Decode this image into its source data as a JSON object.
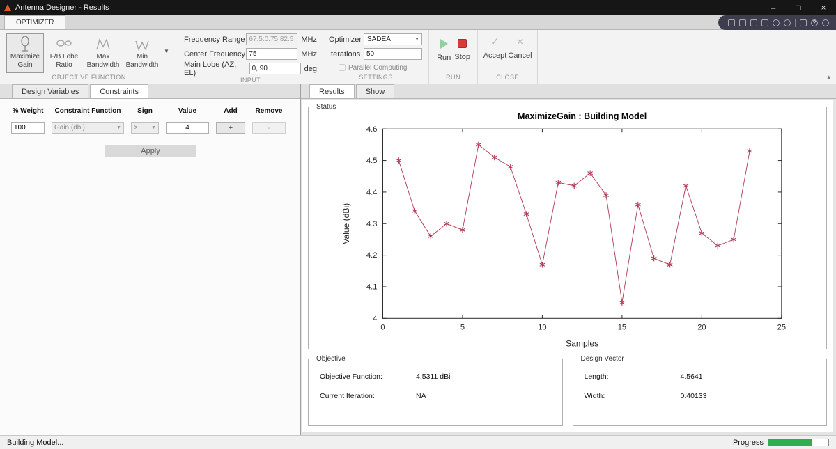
{
  "window": {
    "title": "Antenna Designer - Results"
  },
  "glyphs": {
    "minimize": "–",
    "maximize": "□",
    "close": "×",
    "dropdown": "▼",
    "collapse": "▴",
    "grip": "⋮",
    "accept": "✓",
    "cancel": "×",
    "help": "?"
  },
  "quickbar": {
    "icons": [
      "save-icon",
      "cut-icon",
      "copy-icon",
      "paste-icon",
      "undo-icon",
      "redo-icon",
      "layout-icon",
      "help-icon",
      "account-icon"
    ]
  },
  "ribbon": {
    "tab": "OPTIMIZER",
    "objective": {
      "label": "OBJECTIVE FUNCTION",
      "buttons": [
        {
          "label": "Maximize Gain",
          "icon": "gain-icon",
          "selected": true
        },
        {
          "label": "F/B Lobe Ratio",
          "icon": "lobe-ratio-icon",
          "selected": false
        },
        {
          "label": "Max Bandwidth",
          "icon": "max-bandwidth-icon",
          "selected": false
        },
        {
          "label": "Min Bandwidth",
          "icon": "min-bandwidth-icon",
          "selected": false
        }
      ]
    },
    "input": {
      "label": "INPUT",
      "fields": [
        {
          "label": "Frequency Range",
          "value": "67.5:0.75:82.5",
          "unit": "MHz"
        },
        {
          "label": "Center Frequency",
          "value": "75",
          "unit": "MHz"
        },
        {
          "label": "Main Lobe (AZ, EL)",
          "value": "0, 90",
          "unit": "deg"
        }
      ]
    },
    "settings": {
      "label": "SETTINGS",
      "optimizer_label": "Optimizer",
      "optimizer_value": "SADEA",
      "iterations_label": "Iterations",
      "iterations_value": "50",
      "parallel_label": "Parallel Computing"
    },
    "run": {
      "label": "RUN",
      "run_label": "Run",
      "stop_label": "Stop"
    },
    "close": {
      "label": "CLOSE",
      "accept_label": "Accept",
      "cancel_label": "Cancel"
    }
  },
  "left_panel": {
    "tabs": [
      {
        "label": "Design Variables"
      },
      {
        "label": "Constraints"
      }
    ],
    "table": {
      "headers": [
        "% Weight",
        "Constraint Function",
        "Sign",
        "Value",
        "Add",
        "Remove"
      ],
      "row": {
        "weight": "100",
        "function": "Gain (dbi)",
        "sign": ">",
        "value": "4",
        "add": "+",
        "remove": "-"
      }
    },
    "apply_label": "Apply"
  },
  "right_panel": {
    "tabs": [
      {
        "label": "Results"
      },
      {
        "label": "Show"
      }
    ],
    "status_legend": "Status",
    "objective_box": {
      "legend": "Objective",
      "rows": [
        {
          "label": "Objective Function:",
          "value": "4.5311 dBi"
        },
        {
          "label": "Current Iteration:",
          "value": "NA"
        }
      ]
    },
    "design_vector_box": {
      "legend": "Design Vector",
      "rows": [
        {
          "label": "Length:",
          "value": "4.5641"
        },
        {
          "label": "Width:",
          "value": "0.40133"
        }
      ]
    }
  },
  "statusbar": {
    "message": "Building Model...",
    "progress_label": "Progress",
    "progress_percent": 72,
    "progress_color": "#2fae4e"
  },
  "chart_data": {
    "type": "line",
    "title": "MaximizeGain : Building Model",
    "xlabel": "Samples",
    "ylabel": "Value (dBi)",
    "xlim": [
      0,
      25
    ],
    "ylim": [
      4,
      4.6
    ],
    "xticks": [
      0,
      5,
      10,
      15,
      20,
      25
    ],
    "yticks": [
      4,
      4.1,
      4.2,
      4.3,
      4.4,
      4.5,
      4.6
    ],
    "marker": "*",
    "color": "#b23a55",
    "grid": false,
    "x": [
      1,
      2,
      3,
      4,
      5,
      6,
      7,
      8,
      9,
      10,
      11,
      12,
      13,
      14,
      15,
      16,
      17,
      18,
      19,
      20,
      21,
      22,
      23
    ],
    "y": [
      4.5,
      4.34,
      4.26,
      4.3,
      4.28,
      4.55,
      4.51,
      4.48,
      4.33,
      4.17,
      4.43,
      4.42,
      4.46,
      4.39,
      4.05,
      4.36,
      4.19,
      4.17,
      4.42,
      4.27,
      4.23,
      4.25,
      4.53
    ]
  }
}
